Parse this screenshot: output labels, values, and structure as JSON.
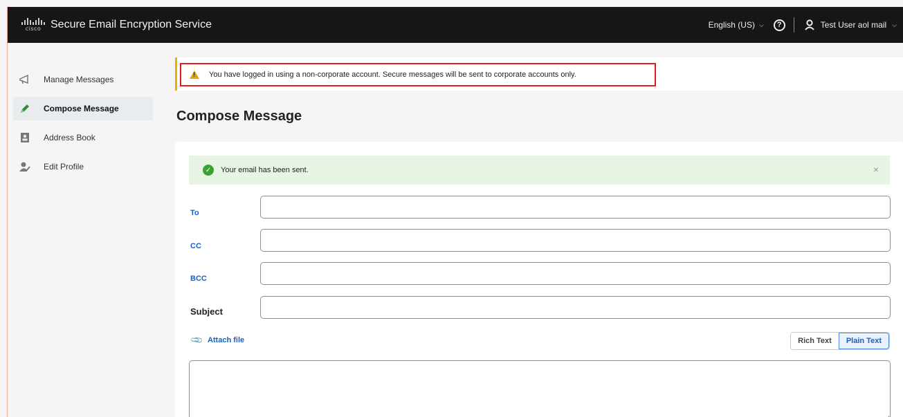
{
  "header": {
    "logo_text": "cisco",
    "app_title": "Secure Email Encryption Service",
    "language": "English (US)",
    "help_symbol": "?",
    "user_name": "Test User aol mail"
  },
  "sidebar": {
    "items": [
      {
        "label": "Manage Messages",
        "icon": "megaphone-icon"
      },
      {
        "label": "Compose Message",
        "icon": "pencil-icon",
        "active": true
      },
      {
        "label": "Address Book",
        "icon": "address-book-icon"
      },
      {
        "label": "Edit Profile",
        "icon": "user-edit-icon"
      }
    ]
  },
  "warning": {
    "text": "You have logged in using a non-corporate account. Secure messages will be sent to corporate accounts only."
  },
  "page": {
    "title": "Compose Message"
  },
  "success": {
    "text": "Your email has been sent.",
    "close_symbol": "×"
  },
  "form": {
    "to_label": "To",
    "to_value": "",
    "cc_label": "CC",
    "cc_value": "",
    "bcc_label": "BCC",
    "bcc_value": "",
    "subject_label": "Subject",
    "subject_value": "",
    "attach_label": "Attach file",
    "rich_text_label": "Rich Text",
    "plain_text_label": "Plain Text",
    "selected_format": "Plain Text",
    "body_value": ""
  },
  "colors": {
    "header_bg": "#161616",
    "link_blue": "#1c5fbd",
    "warning_border": "#e7b400",
    "highlight_red": "#e21c1c",
    "success_bg": "#e8f5e4",
    "success_green": "#3aa335"
  }
}
